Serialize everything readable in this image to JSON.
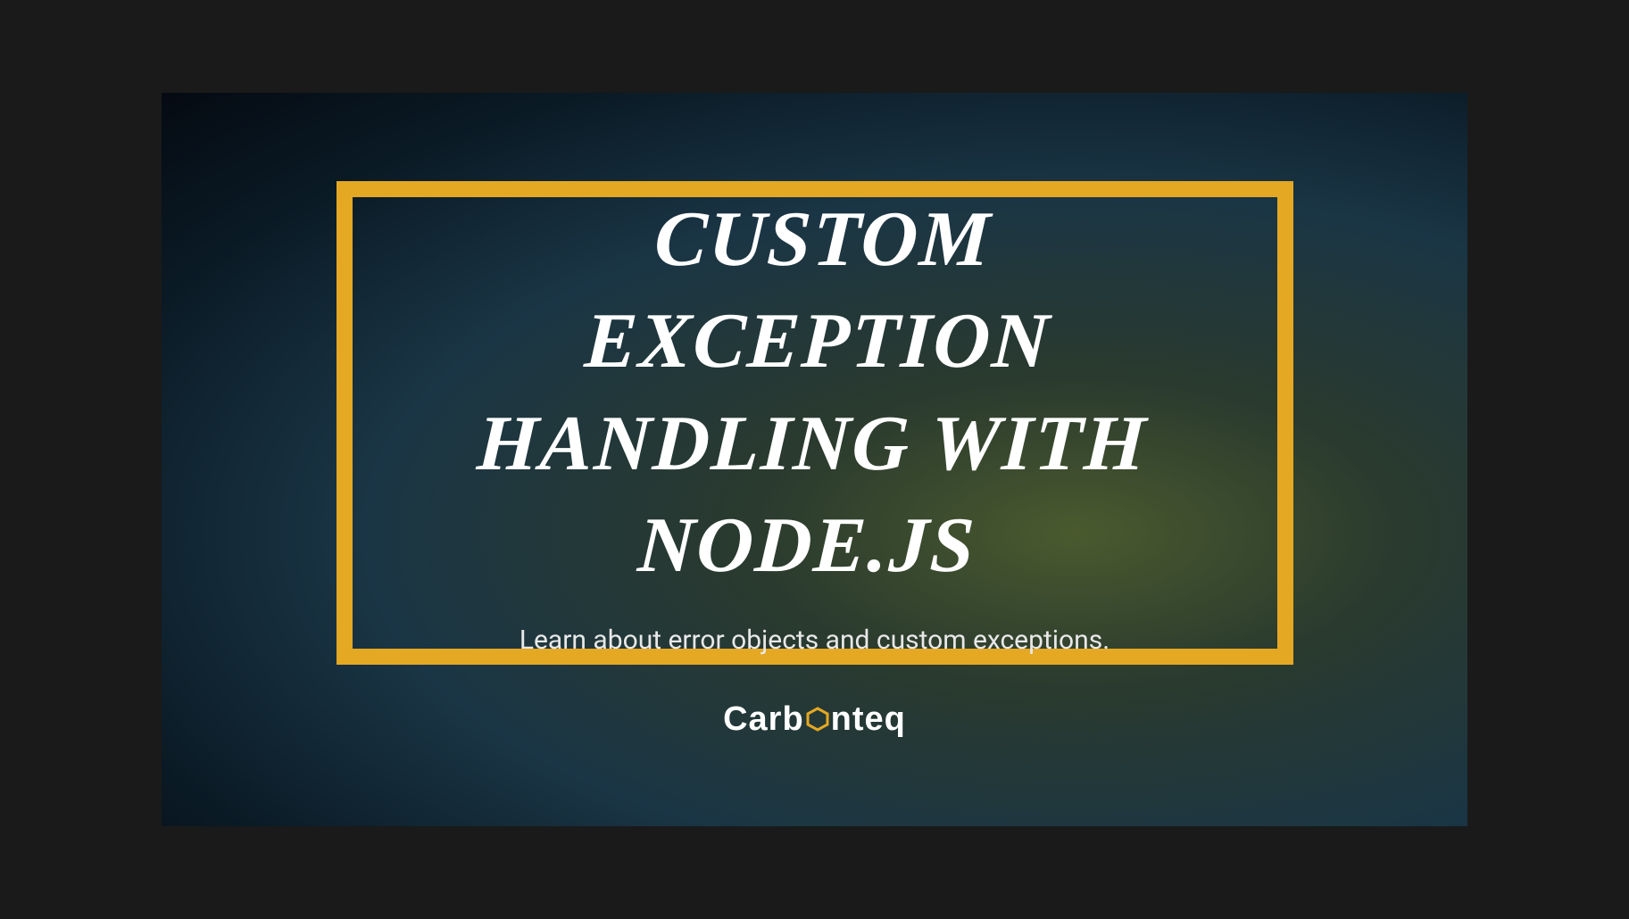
{
  "slide": {
    "title": "CUSTOM EXCEPTION HANDLING WITH NODE.JS",
    "subtitle": "Learn about error objects and custom exceptions."
  },
  "logo": {
    "prefix": "Carb",
    "suffix": "nteq"
  },
  "colors": {
    "accent": "#e5a823",
    "text": "#ffffff"
  }
}
